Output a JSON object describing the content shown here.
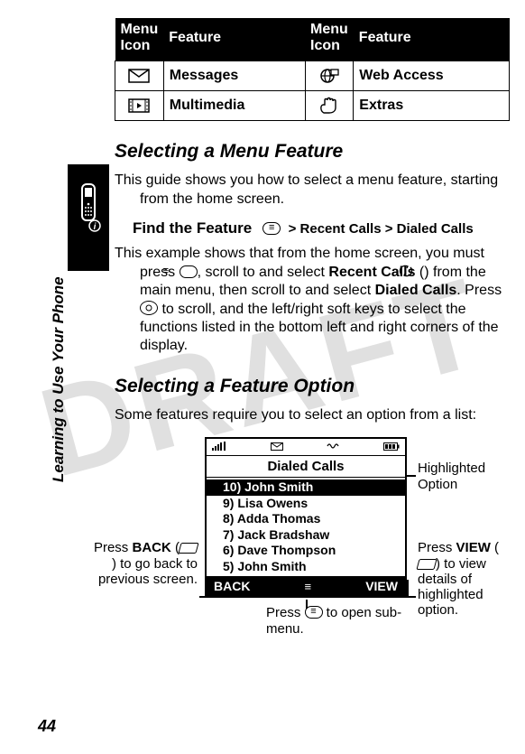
{
  "watermark": "DRAFT",
  "sidebar_label": "Learning to Use Your Phone",
  "page_number": "44",
  "menu_table": {
    "headers": {
      "icon": "Menu Icon",
      "feature": "Feature"
    },
    "rows": [
      {
        "icon": "envelope-icon",
        "feature": "Messages",
        "icon2": "globe-icon",
        "feature2": "Web Access"
      },
      {
        "icon": "film-icon",
        "feature": "Multimedia",
        "icon2": "hand-icon",
        "feature2": "Extras"
      }
    ]
  },
  "section1": {
    "heading": "Selecting a Menu Feature",
    "para1": "This guide shows you how to select a menu feature, starting from the home screen.",
    "find_label": "Find the Feature",
    "breadcrumb": {
      "sep": ">",
      "a": "Recent Calls",
      "b": "Dialed Calls"
    },
    "para2_parts": {
      "t1": "This example shows that from the home screen, you must press ",
      "t2": ", scroll to and select ",
      "feat1": "Recent Calls",
      "t3": " (",
      "t4": ") from the main menu, then scroll to and select ",
      "feat2": "Dialed Calls",
      "t5": ". Press ",
      "t6": " to scroll, and the left/right soft keys to select the functions listed in the bottom left and right corners of the display."
    }
  },
  "section2": {
    "heading": "Selecting a Feature Option",
    "para": "Some features require you to select an option from a list:"
  },
  "screen": {
    "status": {
      "signal": "📶",
      "msg": "✉",
      "vib": "🔔",
      "batt": "▮▮▮"
    },
    "title": "Dialed Calls",
    "items": [
      "10) John Smith",
      "9) Lisa Owens",
      "8) Adda Thomas",
      "7) Jack Bradshaw",
      "6) Dave Thompson",
      "5) John Smith"
    ],
    "soft_left": "BACK",
    "soft_center": "≡",
    "soft_right": "VIEW"
  },
  "callouts": {
    "left": {
      "pre": "Press ",
      "key": "BACK",
      "post1": " (",
      "post2": ") to go back to previous screen."
    },
    "right1": "Highlighted Option",
    "right2": {
      "pre": "Press ",
      "key": "VIEW",
      "post1": " (",
      "post2": ") to view details of highlighted option."
    },
    "bottom": {
      "pre": "Press ",
      "post": " to open sub-menu."
    }
  }
}
